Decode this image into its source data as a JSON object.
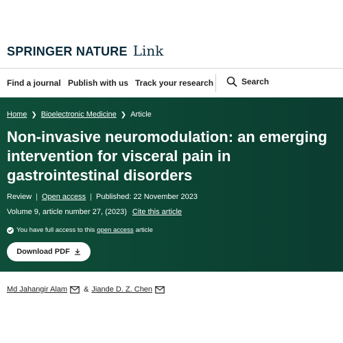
{
  "header": {
    "brand": "SPRINGER NATURE",
    "brand_sub": "Link"
  },
  "nav": {
    "items": [
      {
        "label": "Find a journal"
      },
      {
        "label": "Publish with us"
      },
      {
        "label": "Track your research"
      }
    ],
    "search_label": "Search"
  },
  "breadcrumb": {
    "home": "Home",
    "journal": "Bioelectronic Medicine",
    "current": "Article"
  },
  "article": {
    "title": "Non-invasive neuromodulation: an emerging intervention for visceral pain in gastrointestinal disorders",
    "type": "Review",
    "open_access": "Open access",
    "published": "Published: 22 November 2023",
    "volume": "Volume 9, article number 27, (2023)",
    "cite": "Cite this article",
    "access_prefix": "You have full access to this",
    "access_link": "open access",
    "access_suffix": "article",
    "download": "Download PDF"
  },
  "authors": {
    "list": [
      {
        "name": "Md Jahangir Alam"
      },
      {
        "name": "Jiande D. Z. Chen"
      }
    ],
    "separator": "&"
  },
  "colors": {
    "hero_bg": "#0c4634",
    "brand": "#0a2a3c"
  },
  "icons": [
    "search-icon",
    "chevron-right-icon",
    "check-circle-icon",
    "download-icon",
    "mail-icon"
  ]
}
